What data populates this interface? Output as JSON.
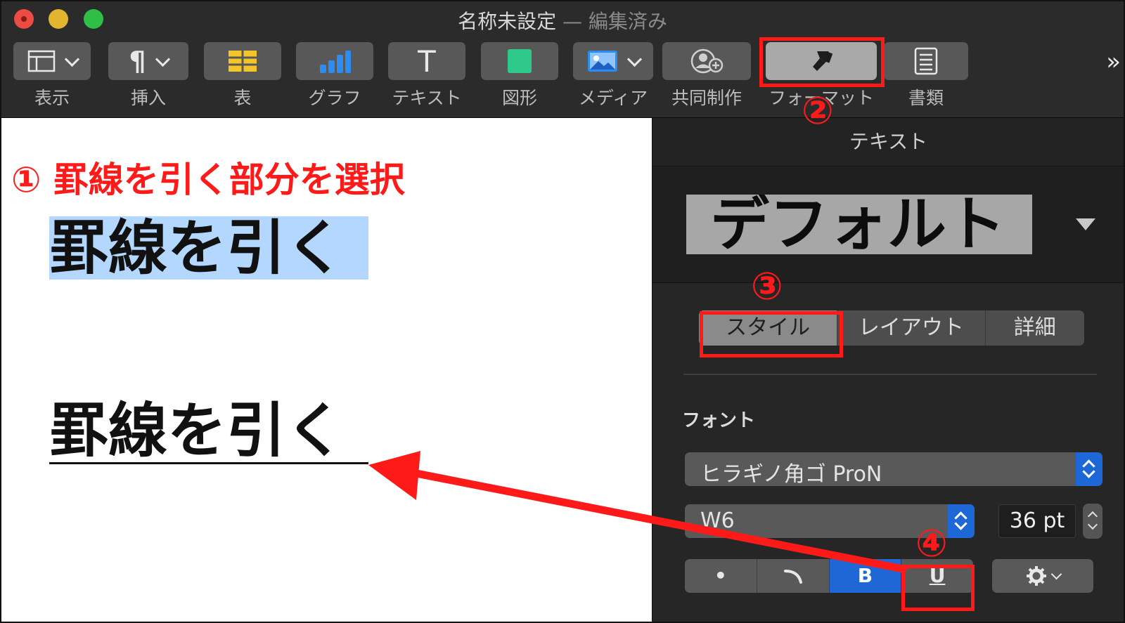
{
  "window": {
    "title": "名称未設定",
    "separator": " — ",
    "status": "編集済み"
  },
  "toolbar": {
    "items": [
      {
        "label": "表示",
        "icon": "view-icon"
      },
      {
        "label": "挿入",
        "icon": "paragraph-icon"
      },
      {
        "label": "表",
        "icon": "table-icon"
      },
      {
        "label": "グラフ",
        "icon": "chart-icon"
      },
      {
        "label": "テキスト",
        "icon": "text-icon"
      },
      {
        "label": "図形",
        "icon": "shape-icon"
      },
      {
        "label": "メディア",
        "icon": "media-icon"
      },
      {
        "label": "共同制作",
        "icon": "collaborate-icon"
      },
      {
        "label": "フォーマット",
        "icon": "format-brush-icon"
      },
      {
        "label": "書類",
        "icon": "document-icon"
      }
    ],
    "insert_glyph": "¶",
    "text_glyph": "T",
    "more_glyph": "»"
  },
  "document": {
    "instruction": "① 罫線を引く部分を選択",
    "selected_text": "罫線を引く",
    "underlined_text": "罫線を引く"
  },
  "sidebar": {
    "tab_label": "テキスト",
    "paragraph_style": "デフォルト",
    "segments": [
      {
        "label": "スタイル",
        "active": true
      },
      {
        "label": "レイアウト",
        "active": false
      },
      {
        "label": "詳細",
        "active": false
      }
    ],
    "font_section_title": "フォント",
    "font_family": "ヒラギノ角ゴ ProN",
    "font_weight": "W6",
    "font_size": "36 pt",
    "style_buttons": [
      {
        "label": "•",
        "name": "bold-dot-button"
      },
      {
        "label": "",
        "name": "italic-button"
      },
      {
        "label": "B",
        "name": "bold-button"
      },
      {
        "label": "U",
        "name": "underline-button"
      }
    ]
  },
  "annotations": {
    "step2": "②",
    "step3": "③",
    "step4": "④",
    "color": "#ff1a1a"
  },
  "colors": {
    "accent_blue": "#1d68d6",
    "selection": "#b3d7ff"
  }
}
